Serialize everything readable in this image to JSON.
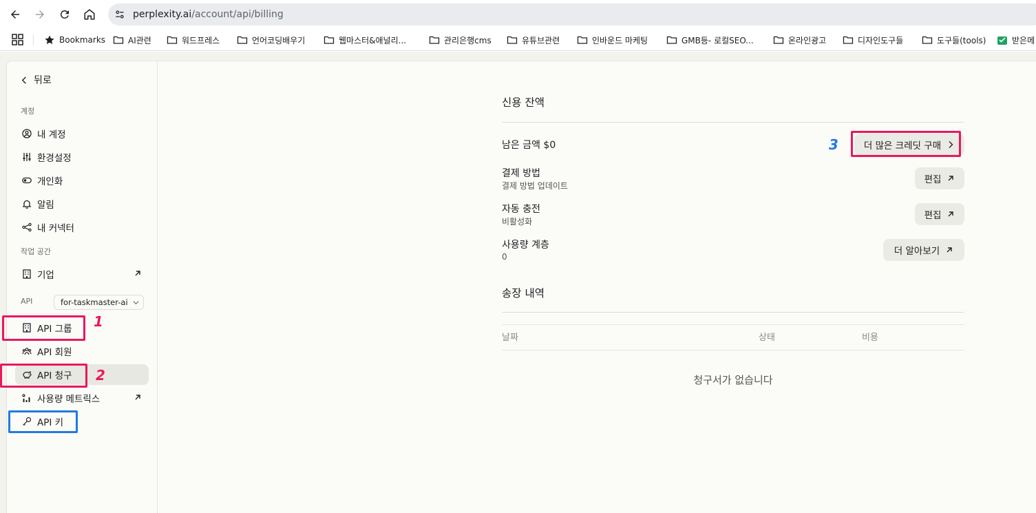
{
  "browser": {
    "url_host": "perplexity.ai",
    "url_path": "/account/api/billing",
    "bookmarks": [
      {
        "label": "Bookmarks",
        "icon": "star-icon"
      },
      {
        "label": "AI관련",
        "icon": "folder-icon"
      },
      {
        "label": "워드프레스",
        "icon": "folder-icon"
      },
      {
        "label": "언어코딩배우기",
        "icon": "folder-icon"
      },
      {
        "label": "웹마스터&애널리...",
        "icon": "folder-icon"
      },
      {
        "label": "관리은행cms",
        "icon": "folder-icon"
      },
      {
        "label": "유튜브관련",
        "icon": "folder-icon"
      },
      {
        "label": "인바운드 마케팅",
        "icon": "folder-icon"
      },
      {
        "label": "GMB등- 로컬SEO...",
        "icon": "folder-icon"
      },
      {
        "label": "온라인광고",
        "icon": "folder-icon"
      },
      {
        "label": "디자인도구들",
        "icon": "folder-icon"
      },
      {
        "label": "도구들(tools)",
        "icon": "folder-icon"
      },
      {
        "label": "받은메",
        "icon": "inbox-icon"
      }
    ]
  },
  "sidebar": {
    "back_label": "뒤로",
    "section_account": "계정",
    "account_items": [
      {
        "label": "내 계정",
        "icon": "user-circle-icon"
      },
      {
        "label": "환경설정",
        "icon": "sliders-icon"
      },
      {
        "label": "개인화",
        "icon": "toggle-icon"
      },
      {
        "label": "알림",
        "icon": "bell-icon"
      },
      {
        "label": "내 커넥터",
        "icon": "share-nodes-icon"
      }
    ],
    "section_workspace": "작업 공간",
    "workspace_item": {
      "label": "기업",
      "icon": "building-icon"
    },
    "api_label": "API",
    "api_selected": "for-taskmaster-ai",
    "api_items": [
      {
        "label": "API 그룹",
        "icon": "building-icon"
      },
      {
        "label": "API 회원",
        "icon": "users-icon"
      },
      {
        "label": "API 청구",
        "icon": "piggy-bank-icon"
      },
      {
        "label": "사용량 메트릭스",
        "icon": "chart-icon"
      },
      {
        "label": "API 키",
        "icon": "key-icon"
      }
    ],
    "active_item": "API 청구"
  },
  "annotations": {
    "num1": "1",
    "num2": "2",
    "num3": "3",
    "colors": {
      "pink": "#e8185f",
      "blue": "#1f7ae0"
    }
  },
  "billing": {
    "credit_title": "신용 잔액",
    "remaining_label": "남은 금액 $0",
    "buy_credits_label": "더 많은 크레딧 구매",
    "payment_label": "결제 방법",
    "payment_sub": "결제 방법 업데이트",
    "payment_button": "편집",
    "autocharge_label": "자동 충전",
    "autocharge_sub": "비활성화",
    "autocharge_button": "편집",
    "tier_label": "사용량 계층",
    "tier_value": "0",
    "tier_button": "더 알아보기",
    "invoice_title": "송장 내역",
    "columns": [
      "날짜",
      "상태",
      "비용"
    ],
    "empty_text": "청구서가 없습니다"
  }
}
